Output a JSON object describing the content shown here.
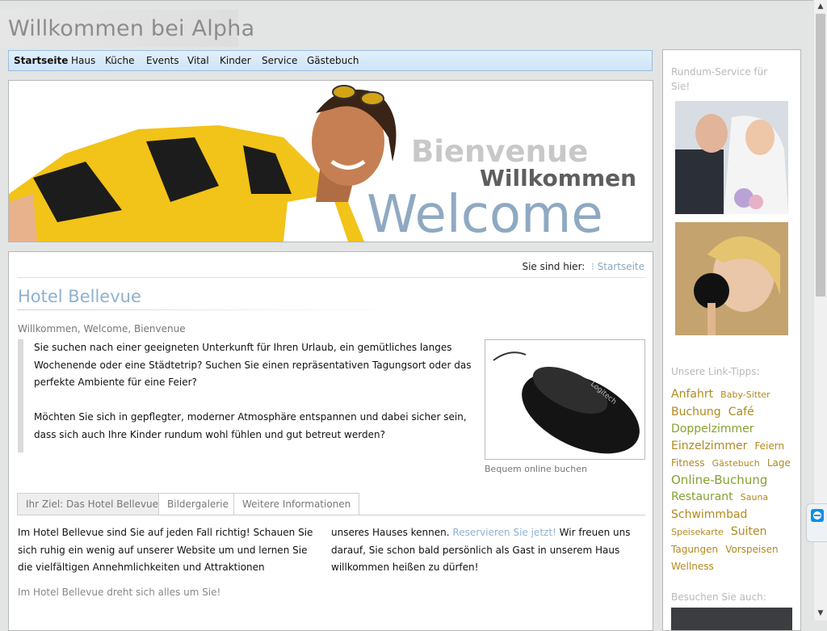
{
  "site": {
    "title": "Willkommen bei Alpha"
  },
  "nav": {
    "items": [
      {
        "label": "Startseite"
      },
      {
        "label": "Haus"
      },
      {
        "label": "Küche"
      },
      {
        "label": "Events"
      },
      {
        "label": "Vital"
      },
      {
        "label": "Kinder"
      },
      {
        "label": "Service"
      },
      {
        "label": "Gästebuch"
      }
    ]
  },
  "banner": {
    "line1": "Bienvenue",
    "line2": "Willkommen",
    "line3": "Welcome"
  },
  "breadcrumb": {
    "prefix": "Sie sind hier:",
    "link": "Startseite"
  },
  "content": {
    "title": "Hotel Bellevue",
    "subtitle": "Willkommen, Welcome, Bienvenue",
    "quote_p1": "Sie suchen nach einer geeigneten Unterkunft für Ihren Urlaub, ein gemütliches langes Wochenende oder eine Städtetrip? Suchen Sie einen repräsentativen Tagungsort oder das perfekte Ambiente für eine Feier?",
    "quote_p2": "Möchten Sie sich in gepflegter, moderner Atmosphäre entspannen und dabei sicher sein, dass sich auch Ihre Kinder rundum wohl fühlen und gut betreut werden?",
    "image_caption": "Bequem online buchen",
    "mouse_brand": "Logitech",
    "tabs": [
      {
        "label": "Ihr Ziel: Das Hotel Bellevue"
      },
      {
        "label": "Bildergalerie"
      },
      {
        "label": "Weitere Informationen"
      }
    ],
    "col1": "Im Hotel Bellevue sind Sie auf jeden Fall richtig! Schauen Sie sich ruhig ein wenig auf unserer Website um und lernen Sie die vielfältigen Annehmlichkeiten und Attraktionen",
    "col2_a": "unseres Hauses kennen.",
    "col2_link": "Reservieren Sie jetzt!",
    "col2_b": "Wir freuen uns darauf, Sie schon bald persönlich als Gast in unserem Haus willkommen heißen zu dürfen!",
    "focus": "Im Hotel Bellevue dreht sich alles um Sie!"
  },
  "sidebar": {
    "service_heading": "Rundum-Service für Sie!",
    "links_heading": "Unsere Link-Tipps:",
    "tags": [
      {
        "label": "Anfahrt",
        "size": 3
      },
      {
        "label": "Baby-Sitter",
        "size": 1
      },
      {
        "label": "Buchung",
        "size": 3
      },
      {
        "label": "Café",
        "size": 3
      },
      {
        "label": "Doppelzimmer",
        "size": 3,
        "accent": true
      },
      {
        "label": "Einzelzimmer",
        "size": 3
      },
      {
        "label": "Feiern",
        "size": 2
      },
      {
        "label": "Fitness",
        "size": 2
      },
      {
        "label": "Gästebuch",
        "size": 1
      },
      {
        "label": "Lage",
        "size": 2
      },
      {
        "label": "Online-Buchung",
        "size": 3,
        "accent": true
      },
      {
        "label": "Restaurant",
        "size": 3,
        "accent": true
      },
      {
        "label": "Sauna",
        "size": 1
      },
      {
        "label": "Schwimmbad",
        "size": 3
      },
      {
        "label": "Speisekarte",
        "size": 1
      },
      {
        "label": "Suiten",
        "size": 3
      },
      {
        "label": "Tagungen",
        "size": 2
      },
      {
        "label": "Vorspeisen",
        "size": 2
      },
      {
        "label": "Wellness",
        "size": 2
      }
    ],
    "visit_heading": "Besuchen Sie auch:"
  },
  "colors": {
    "accent_blue": "#8fb1cd",
    "tag_gold": "#b08a1e",
    "tag_green": "#86a132",
    "nav_bg": "#d9eaf8"
  }
}
